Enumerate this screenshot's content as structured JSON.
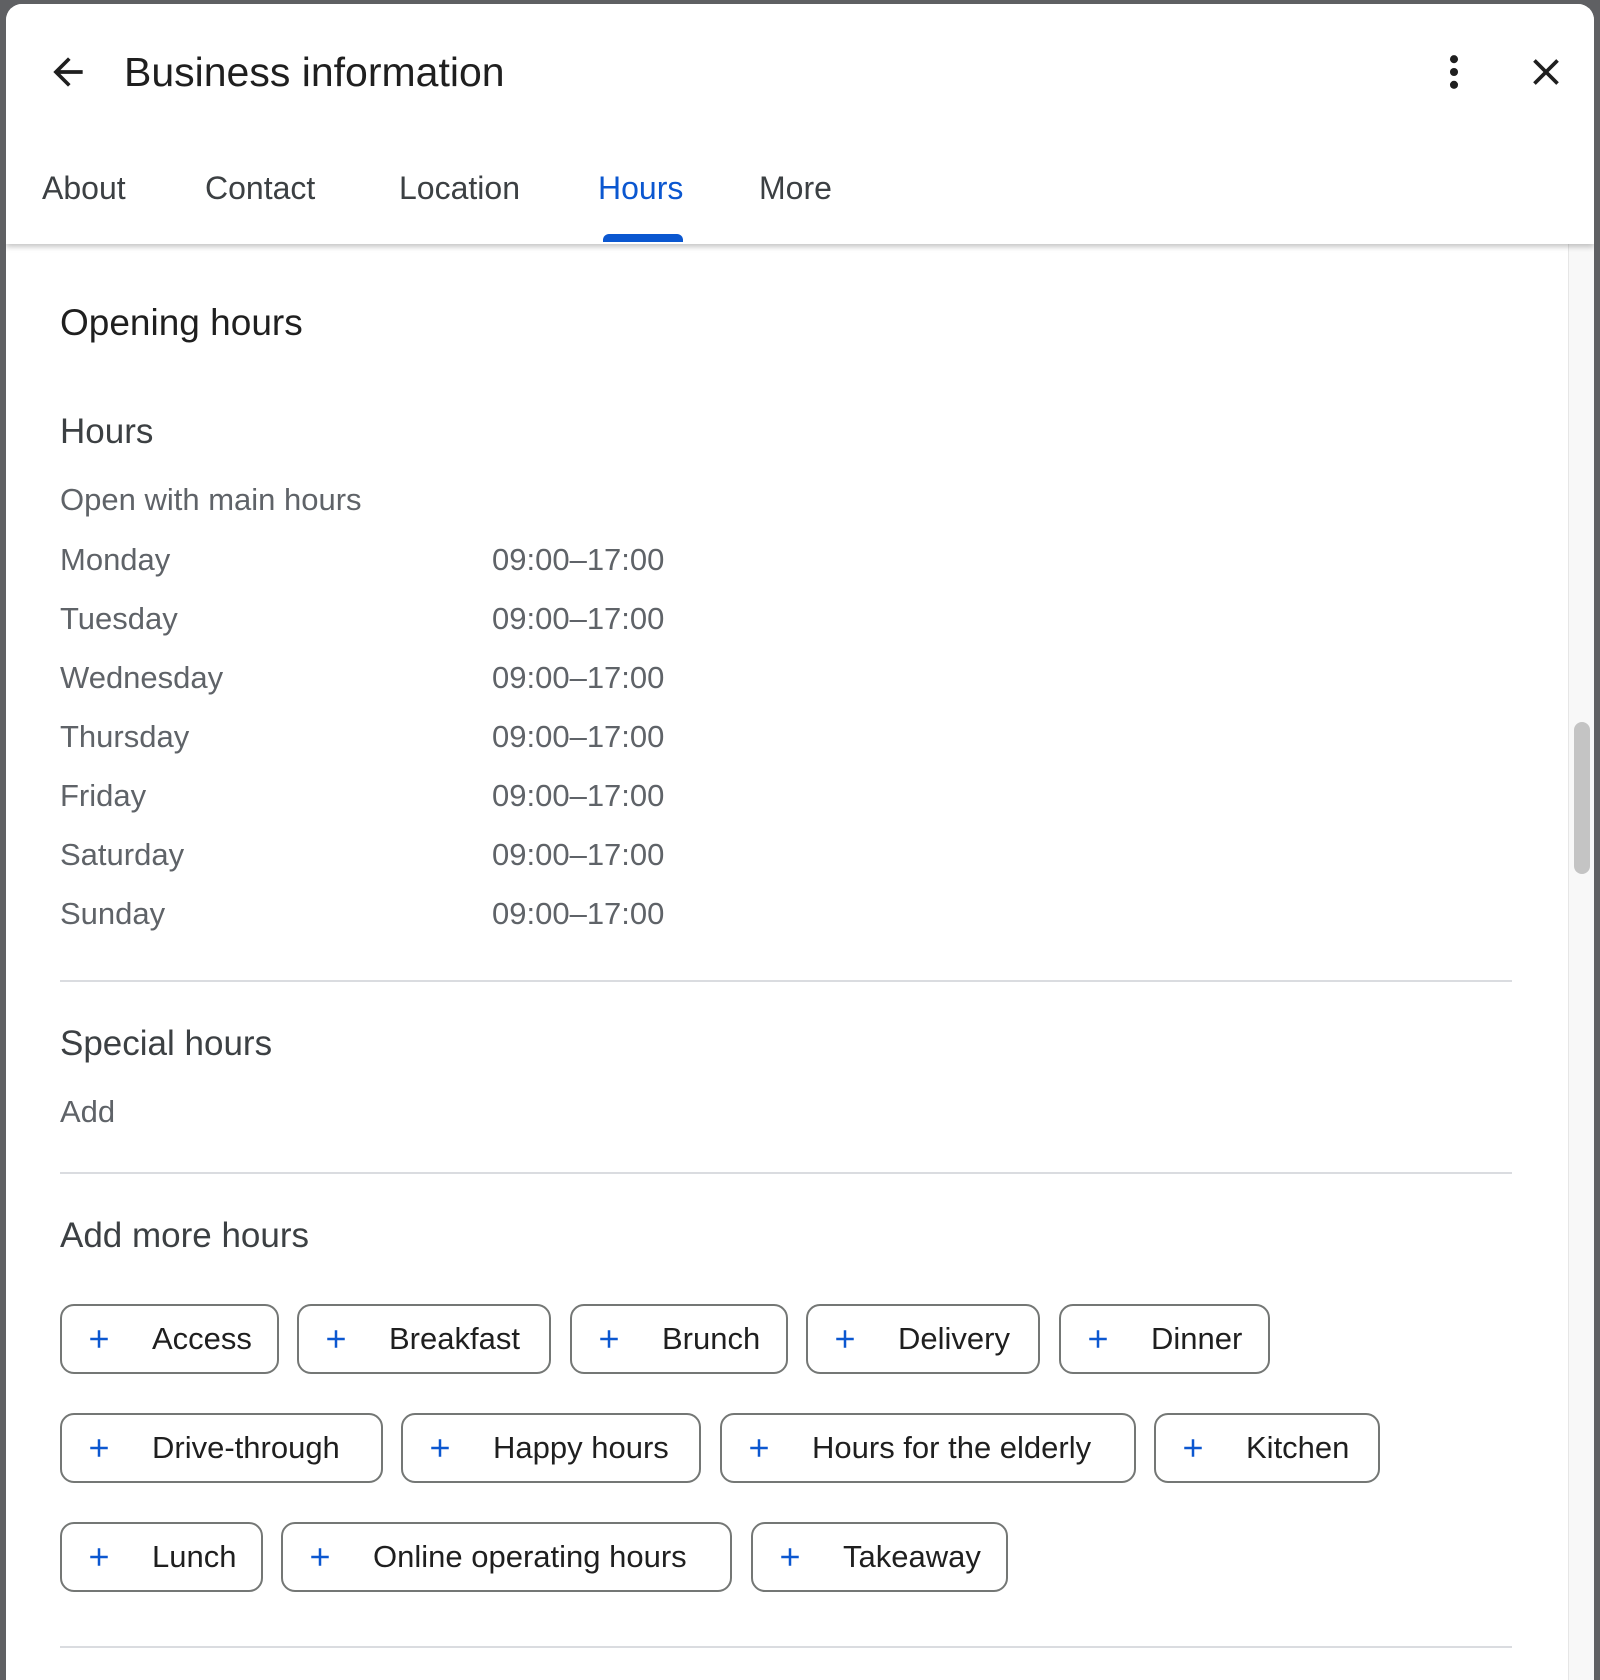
{
  "header": {
    "title": "Business information"
  },
  "icons": {
    "back": "arrow-back-icon",
    "more": "more-vert-icon",
    "close": "close-icon",
    "add": "plus-icon"
  },
  "tabs": [
    {
      "label": "About"
    },
    {
      "label": "Contact"
    },
    {
      "label": "Location"
    },
    {
      "label": "Hours"
    },
    {
      "label": "More"
    }
  ],
  "active_tab": "Hours",
  "colors": {
    "accent": "#0b57d0",
    "text_primary": "#1f1f1f",
    "text_secondary": "#5f6368",
    "divider": "#dadce0"
  },
  "opening": {
    "heading": "Opening hours",
    "hours_heading": "Hours",
    "status": "Open with main hours",
    "days": [
      {
        "day": "Monday",
        "time": "09:00–17:00"
      },
      {
        "day": "Tuesday",
        "time": "09:00–17:00"
      },
      {
        "day": "Wednesday",
        "time": "09:00–17:00"
      },
      {
        "day": "Thursday",
        "time": "09:00–17:00"
      },
      {
        "day": "Friday",
        "time": "09:00–17:00"
      },
      {
        "day": "Saturday",
        "time": "09:00–17:00"
      },
      {
        "day": "Sunday",
        "time": "09:00–17:00"
      }
    ]
  },
  "special": {
    "heading": "Special hours",
    "add_label": "Add"
  },
  "more_hours": {
    "heading": "Add more hours",
    "chips": [
      "Access",
      "Breakfast",
      "Brunch",
      "Delivery",
      "Dinner",
      "Drive-through",
      "Happy hours",
      "Hours for the elderly",
      "Kitchen",
      "Lunch",
      "Online operating hours",
      "Takeaway"
    ]
  }
}
